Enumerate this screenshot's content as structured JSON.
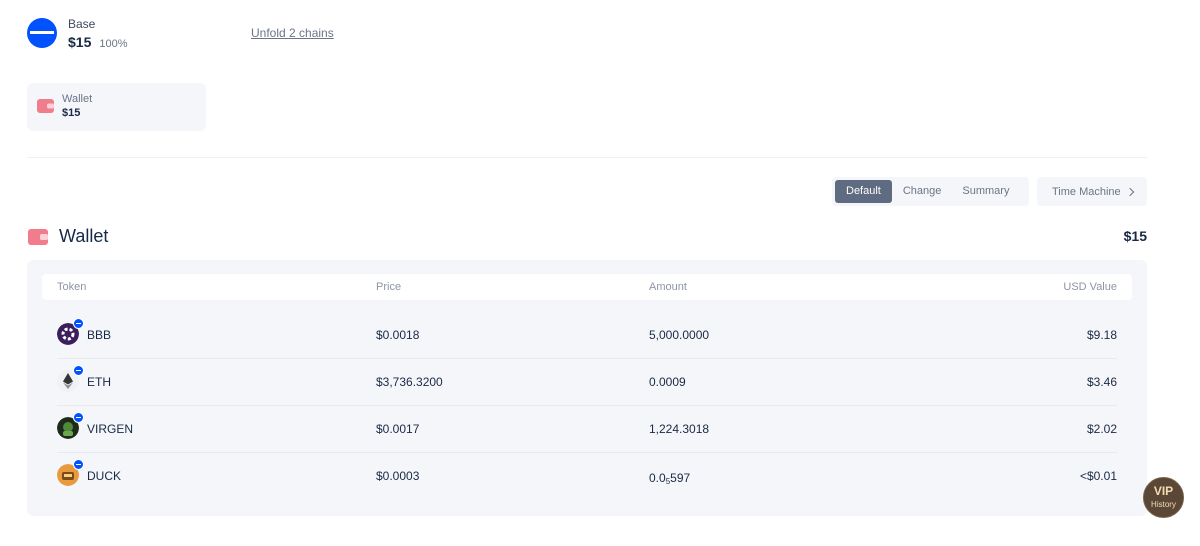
{
  "chain": {
    "name": "Base",
    "amount": "$15",
    "percent": "100%",
    "unfold_label": "Unfold 2 chains"
  },
  "wallet_card": {
    "label": "Wallet",
    "amount": "$15",
    "icon": "wallet-icon"
  },
  "view_tabs": {
    "default": "Default",
    "change": "Change",
    "summary": "Summary",
    "selected": "Default"
  },
  "time_machine": {
    "label": "Time Machine"
  },
  "section": {
    "title": "Wallet",
    "total": "$15"
  },
  "table": {
    "headers": {
      "token": "Token",
      "price": "Price",
      "amount": "Amount",
      "usd_value": "USD Value"
    },
    "rows": [
      {
        "token": "BBB",
        "price": "$0.0018",
        "amount": "5,000.0000",
        "usd_value": "$9.18"
      },
      {
        "token": "ETH",
        "price": "$3,736.3200",
        "amount": "0.0009",
        "usd_value": "$3.46"
      },
      {
        "token": "VIRGEN",
        "price": "$0.0017",
        "amount": "1,224.3018",
        "usd_value": "$2.02"
      },
      {
        "token": "DUCK",
        "price": "$0.0003",
        "amount_prefix": "0.0",
        "amount_sub": "5",
        "amount_suffix": "597",
        "usd_value": "<$0.01"
      }
    ]
  },
  "vip_badge": {
    "line1": "VIP",
    "line2": "History"
  },
  "colors": {
    "base_blue": "#0052ff",
    "wallet_pink": "#f07c8c",
    "tab_active": "#5f6b80",
    "vip_brown": "#5a4735"
  }
}
